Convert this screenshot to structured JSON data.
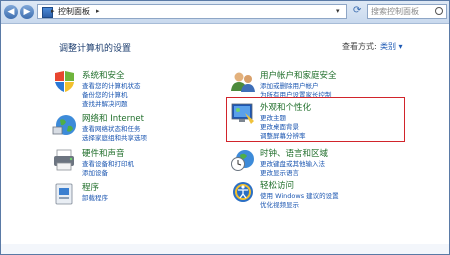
{
  "address": {
    "path": "控制面板",
    "search_placeholder": "搜索控制面板"
  },
  "header": {
    "title": "调整计算机的设置",
    "view_by_label": "查看方式:",
    "view_by_value": "类别"
  },
  "categories": [
    {
      "title": "系统和安全",
      "links": [
        "查看您的计算机状态",
        "备份您的计算机",
        "查找并解决问题"
      ]
    },
    {
      "title": "网络和 Internet",
      "links": [
        "查看网络状态和任务",
        "选择家庭组和共享选项"
      ]
    },
    {
      "title": "硬件和声音",
      "links": [
        "查看设备和打印机",
        "添加设备"
      ]
    },
    {
      "title": "程序",
      "links": [
        "卸载程序"
      ]
    },
    {
      "title": "用户帐户和家庭安全",
      "links": [
        "添加或删除用户帐户",
        "为所有用户设置家长控制"
      ]
    },
    {
      "title": "外观和个性化",
      "links": [
        "更改主题",
        "更改桌面背景",
        "调整屏幕分辨率"
      ]
    },
    {
      "title": "时钟、语言和区域",
      "links": [
        "更改键盘或其他输入法",
        "更改显示语言"
      ]
    },
    {
      "title": "轻松访问",
      "links": [
        "使用 Windows 建议的设置",
        "优化视频显示"
      ]
    }
  ]
}
